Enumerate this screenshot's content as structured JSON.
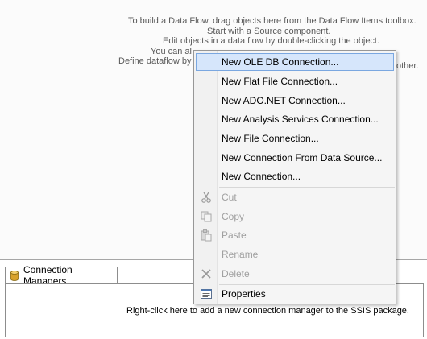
{
  "designer": {
    "hint_lines": [
      "To build a Data Flow, drag objects here from the Data Flow Items toolbox.",
      "Start with a Source component.",
      "Edit objects in a data flow by double-clicking the object.",
      "You can al",
      "Define dataflow by d",
      "other."
    ]
  },
  "connection_managers": {
    "tab_label": "Connection Managers",
    "message": "Right-click here to add a new connection manager to the SSIS package."
  },
  "context_menu": {
    "items": [
      {
        "label": "New OLE DB Connection...",
        "enabled": true,
        "highlighted": true
      },
      {
        "label": "New Flat File Connection...",
        "enabled": true
      },
      {
        "label": "New ADO.NET Connection...",
        "enabled": true
      },
      {
        "label": "New Analysis Services Connection...",
        "enabled": true
      },
      {
        "label": "New File Connection...",
        "enabled": true
      },
      {
        "label": "New Connection From Data Source...",
        "enabled": true
      },
      {
        "label": "New Connection...",
        "enabled": true
      },
      {
        "label": "Cut",
        "enabled": false,
        "icon": "scissors-icon"
      },
      {
        "label": "Copy",
        "enabled": false,
        "icon": "copy-icon"
      },
      {
        "label": "Paste",
        "enabled": false,
        "icon": "paste-icon"
      },
      {
        "label": "Rename",
        "enabled": false
      },
      {
        "label": "Delete",
        "enabled": false,
        "icon": "delete-icon"
      },
      {
        "label": "Properties",
        "enabled": true,
        "icon": "properties-icon"
      }
    ]
  },
  "colors": {
    "highlight_bg": "#d6e6fb",
    "highlight_border": "#7aa7e0",
    "disabled_text": "#a0a0a0"
  }
}
